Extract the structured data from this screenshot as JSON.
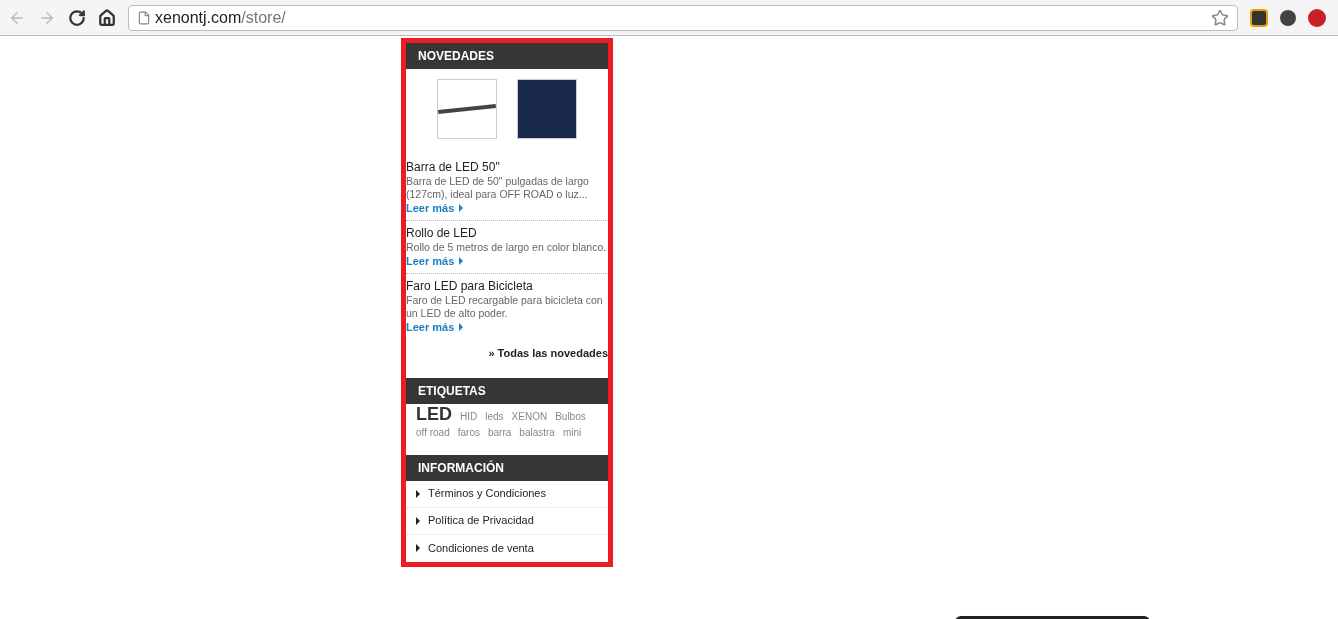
{
  "browser": {
    "url_host": "xenontj.com",
    "url_path": "/store/"
  },
  "novedades": {
    "title": "NOVEDADES",
    "items": [
      {
        "title": "Barra de LED 50\"",
        "description": "Barra de LED de 50\" pulgadas de largo (127cm), ideal para OFF ROAD o luz...",
        "link": "Leer más"
      },
      {
        "title": "Rollo de LED",
        "description": "Rollo de 5 metros de largo en color blanco.",
        "link": "Leer más"
      },
      {
        "title": "Faro LED para Bicicleta",
        "description": "Faro de LED recargable para bicicleta con un LED de alto poder.",
        "link": "Leer más"
      }
    ],
    "all_link": "» Todas las novedades"
  },
  "etiquetas": {
    "title": "ETIQUETAS",
    "tags": [
      {
        "label": "LED",
        "kind": "large"
      },
      {
        "label": "HID",
        "kind": "small"
      },
      {
        "label": "leds",
        "kind": "small"
      },
      {
        "label": "XENON",
        "kind": "small"
      },
      {
        "label": "Bulbos",
        "kind": "small"
      },
      {
        "label": "off road",
        "kind": "small"
      },
      {
        "label": "faros",
        "kind": "small"
      },
      {
        "label": "barra",
        "kind": "small"
      },
      {
        "label": "balastra",
        "kind": "small"
      },
      {
        "label": "mini",
        "kind": "small"
      }
    ]
  },
  "informacion": {
    "title": "INFORMACIÓN",
    "links": [
      "Términos y Condiciones",
      "Política de Privacidad",
      "Condiciones de venta"
    ]
  }
}
